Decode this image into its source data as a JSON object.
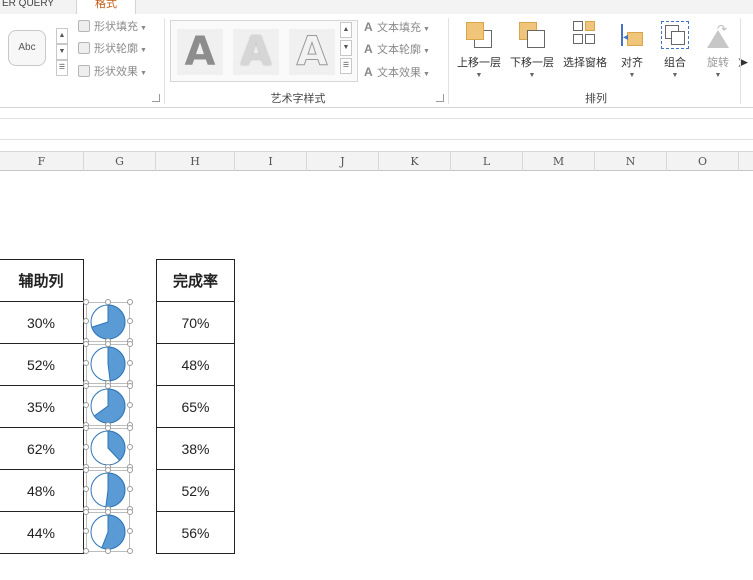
{
  "tabs": {
    "left_label": "ER QUERY",
    "active_label": "格式"
  },
  "shape_styles": {
    "preview_label": "Abc",
    "commands": [
      "形状填充",
      "形状轮廓",
      "形状效果"
    ]
  },
  "wordart": {
    "group_label": "艺术字样式",
    "sample_letter": "A",
    "commands": [
      "文本填充",
      "文本轮廓",
      "文本效果"
    ]
  },
  "arrange": {
    "group_label": "排列",
    "buttons": [
      "上移一层",
      "下移一层",
      "选择窗格",
      "对齐",
      "组合",
      "旋转"
    ]
  },
  "columns": [
    "F",
    "G",
    "H",
    "I",
    "J",
    "K",
    "L",
    "M",
    "N",
    "O"
  ],
  "table_helper": {
    "header": "辅助列",
    "values": [
      "30%",
      "52%",
      "35%",
      "62%",
      "48%",
      "44%"
    ]
  },
  "table_completion": {
    "header": "完成率",
    "values": [
      "70%",
      "48%",
      "65%",
      "38%",
      "52%",
      "56%"
    ]
  },
  "pie_fill_fractions": [
    0.7,
    0.48,
    0.65,
    0.38,
    0.52,
    0.56
  ],
  "colors": {
    "pie_fill": "#5b9bd5",
    "pie_stroke": "#2e75b6",
    "accent_tab": "#c55a11",
    "gold": "#f0c57a"
  }
}
